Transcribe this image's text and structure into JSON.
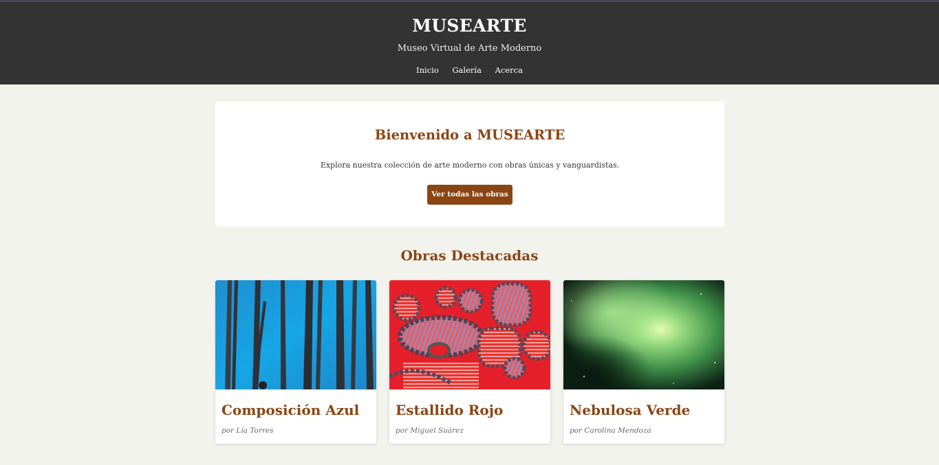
{
  "header": {
    "brand": "MUSEARTE",
    "tagline": "Museo Virtual de Arte Moderno",
    "nav": [
      "Inicio",
      "Galería",
      "Acerca"
    ]
  },
  "welcome": {
    "title": "Bienvenido a MUSEARTE",
    "text": "Explora nuestra colección de arte moderno con obras únicas y vanguardistas.",
    "button": "Ver todas las obras"
  },
  "featured": {
    "title": "Obras Destacadas",
    "cards": [
      {
        "title": "Composición Azul",
        "author": "por Lía Torres",
        "image": "blue-forest-painting"
      },
      {
        "title": "Estallido Rojo",
        "author": "por Miguel Suárez",
        "image": "red-abstract-painting"
      },
      {
        "title": "Nebulosa Verde",
        "author": "por Carolina Mendoza",
        "image": "green-nebula-image"
      }
    ]
  },
  "colors": {
    "header_bg": "#333333",
    "accent": "#8b4513",
    "page_bg": "#f3f3ee"
  }
}
